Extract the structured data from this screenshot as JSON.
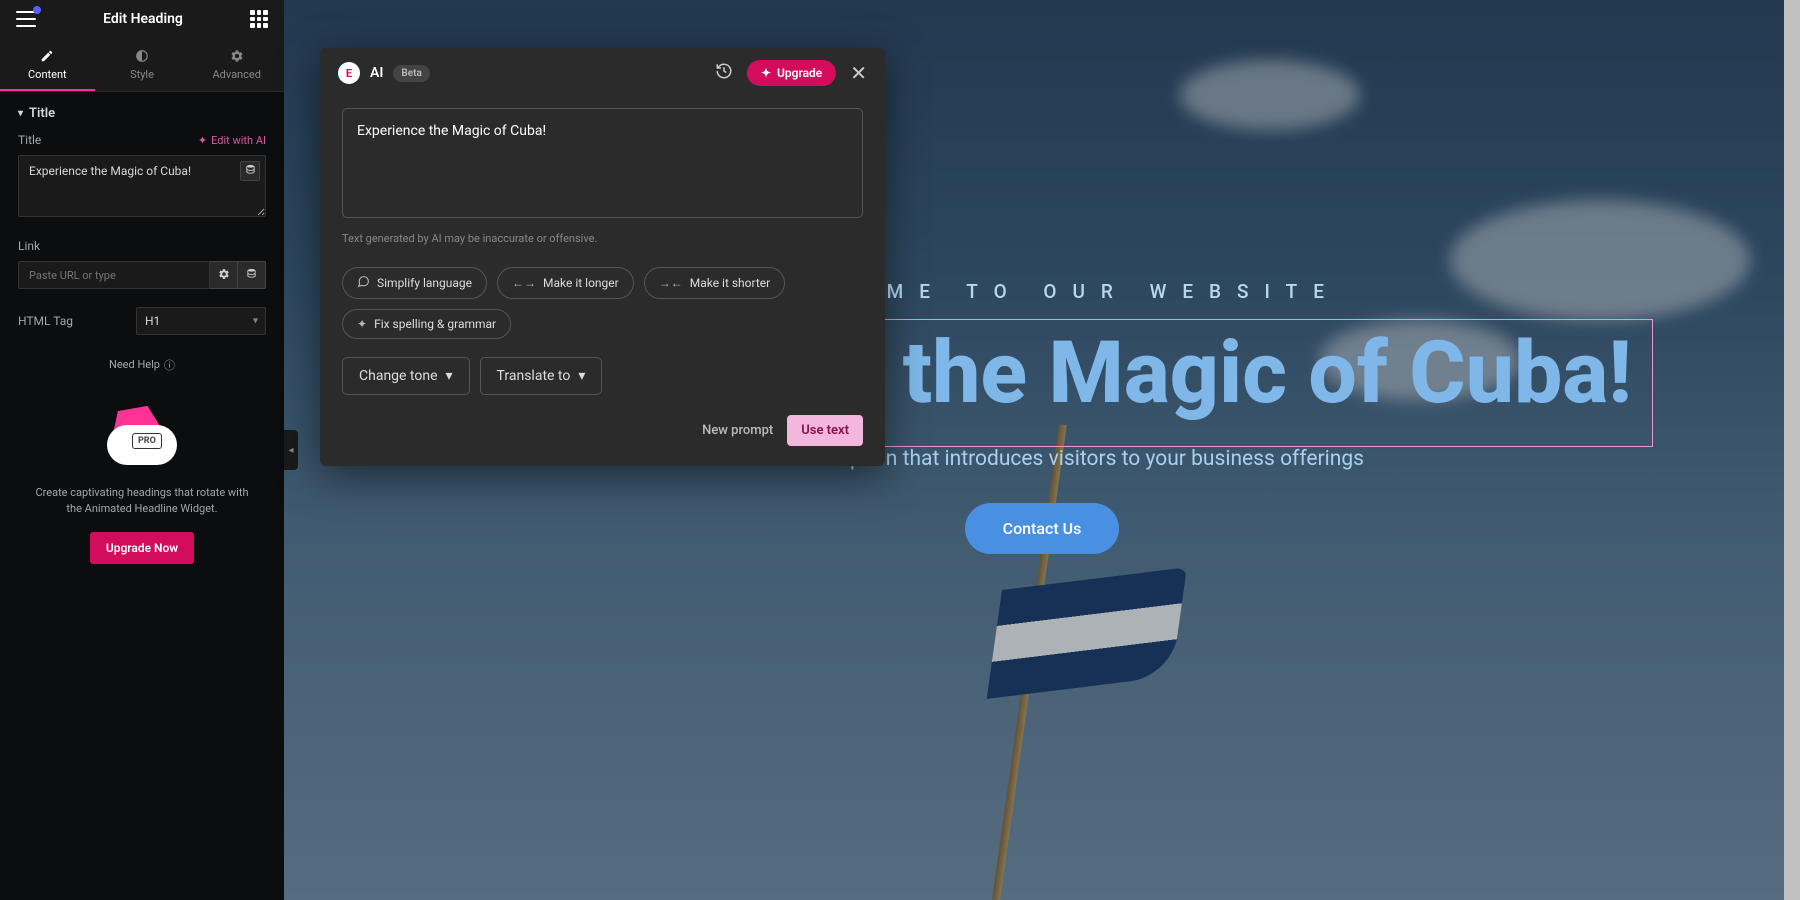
{
  "panel": {
    "header_title": "Edit Heading",
    "tabs": {
      "content": "Content",
      "style": "Style",
      "advanced": "Advanced"
    },
    "section_title": "Title",
    "title_label": "Title",
    "edit_with_ai": "Edit with AI",
    "title_value": "Experience the Magic of Cuba!",
    "link_label": "Link",
    "link_placeholder": "Paste URL or type",
    "tag_label": "HTML Tag",
    "tag_value": "H1",
    "need_help": "Need Help",
    "promo_badge": "PRO",
    "promo_text": "Create captivating headings that rotate with the Animated Headline Widget.",
    "upgrade_now": "Upgrade Now"
  },
  "ai": {
    "title": "AI",
    "beta": "Beta",
    "upgrade": "Upgrade",
    "textarea_value": "Experience the Magic of Cuba!",
    "disclaimer": "Text generated by AI may be inaccurate or offensive.",
    "chips": {
      "simplify": "Simplify language",
      "longer": "Make it longer",
      "shorter": "Make it shorter",
      "spelling": "Fix spelling & grammar"
    },
    "change_tone": "Change tone",
    "translate_to": "Translate to",
    "new_prompt": "New prompt",
    "use_text": "Use text"
  },
  "canvas": {
    "eyebrow": "WELCOME TO OUR WEBSITE",
    "heading": "Experience the Magic of Cuba!",
    "subhead": "A short description that introduces visitors to your business offerings",
    "cta": "Contact Us"
  }
}
